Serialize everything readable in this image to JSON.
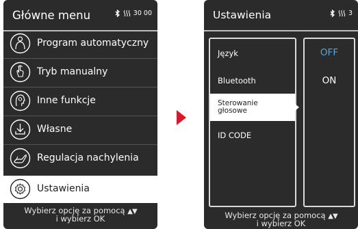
{
  "left_screen": {
    "title": "Główne menu",
    "status_text": "30 00",
    "menu": [
      {
        "label": "Program automatyczny",
        "icon": "person-icon"
      },
      {
        "label": "Tryb manualny",
        "icon": "hand-icon"
      },
      {
        "label": "Inne funkcje",
        "icon": "head-icon"
      },
      {
        "label": "Własne",
        "icon": "download-icon"
      },
      {
        "label": "Regulacja nachylenia",
        "icon": "recline-chair-icon"
      },
      {
        "label": "Ustawienia",
        "icon": "gear-icon",
        "selected": true
      }
    ],
    "footer_line1": "Wybierz opcję za pomocą",
    "footer_arrows": "▲▼",
    "footer_line2": "i wybierz OK"
  },
  "right_screen": {
    "title": "Ustawienia",
    "status_text": "3",
    "settings": [
      {
        "label": "Język"
      },
      {
        "label": "Bluetooth"
      },
      {
        "label_line1": "Sterowanie",
        "label_line2": "głosowe",
        "selected": true
      },
      {
        "label": "ID CODE"
      }
    ],
    "values": [
      {
        "label": "OFF",
        "color": "#5ba4d8"
      },
      {
        "label": "ON",
        "color": "#ffffff"
      }
    ],
    "footer_line1": "Wybierz opcję za pomocą",
    "footer_arrows": "▲▼",
    "footer_line2": "i wybierz OK"
  },
  "colors": {
    "screen_bg": "#2b2b2b",
    "accent_arrow": "#d8192c",
    "off_value": "#5ba4d8"
  }
}
